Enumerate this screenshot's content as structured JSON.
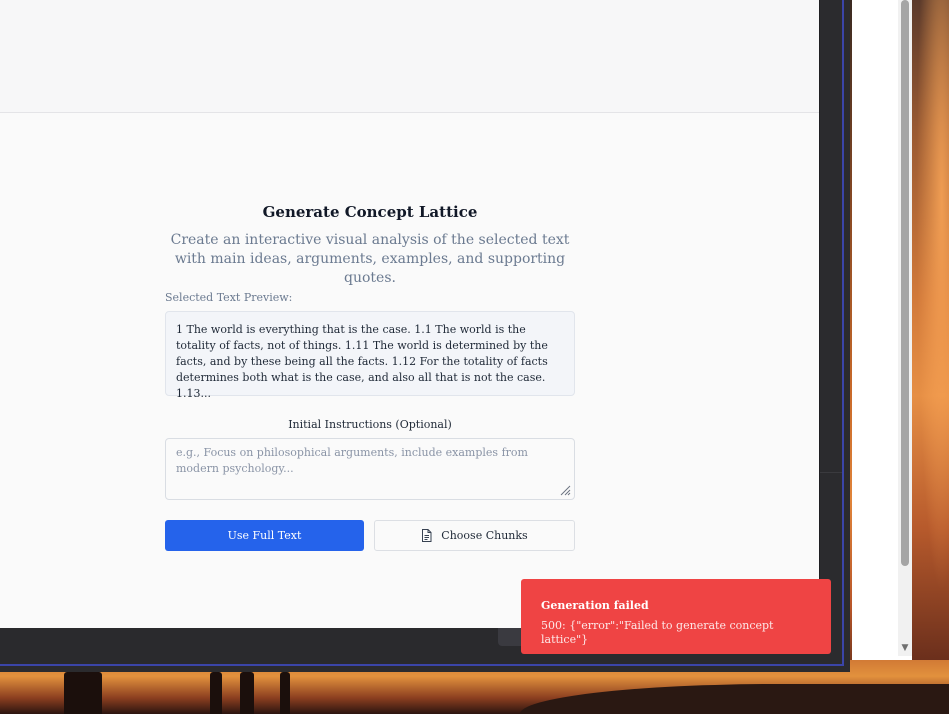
{
  "dialog": {
    "title": "Generate Concept Lattice",
    "subtitle": "Create an interactive visual analysis of the selected text with main ideas, arguments, examples, and supporting quotes.",
    "preview_label": "Selected Text Preview:",
    "preview_text": "1 The world is everything that is the case. 1.1 The world is the totality of facts, not of things. 1.11 The world is determined by the facts, and by these being all the facts. 1.12 For the totality of facts determines both what is the case, and also all that is not the case. 1.13...",
    "instructions_label": "Initial Instructions (Optional)",
    "instructions_placeholder": "e.g., Focus on philosophical arguments, include examples from modern psychology...",
    "instructions_value": "",
    "use_full_text_label": "Use Full Text",
    "choose_chunks_label": "Choose Chunks",
    "choose_chunks_icon": "file-text-icon"
  },
  "toast": {
    "title": "Generation failed",
    "message": "500: {\"error\":\"Failed to generate concept lattice\"}",
    "color": "#ef4444"
  },
  "colors": {
    "primary": "#2563eb",
    "toast_error": "#ef4444",
    "window_border": "#3b45a8"
  }
}
